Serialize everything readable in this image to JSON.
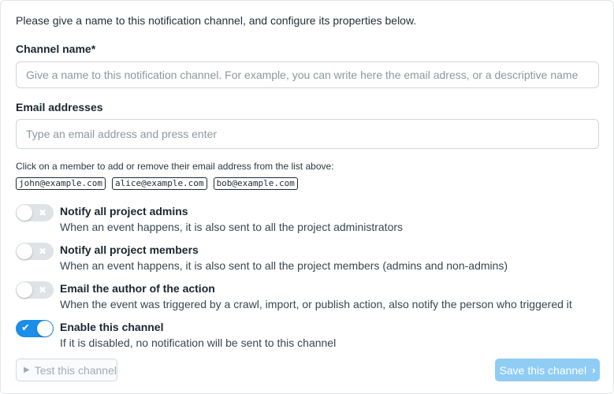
{
  "intro": "Please give a name to this notification channel, and configure its properties below.",
  "channel_name": {
    "label": "Channel name*",
    "value": "",
    "placeholder": "Give a name to this notification channel. For example, you can write here the email adress, or a descriptive name"
  },
  "email": {
    "label": "Email addresses",
    "value": "",
    "placeholder": "Type an email address and press enter"
  },
  "members": {
    "hint": "Click on a member to add or remove their email address from the list above:",
    "items": [
      "john@example.com",
      "alice@example.com",
      "bob@example.com"
    ]
  },
  "options": [
    {
      "title": "Notify all project admins",
      "desc": "When an event happens, it is also sent to all the project administrators",
      "enabled": false,
      "mark": "✖"
    },
    {
      "title": "Notify all project members",
      "desc": "When an event happens, it is also sent to all the project members (admins and non-admins)",
      "enabled": false,
      "mark": "✖"
    },
    {
      "title": "Email the author of the action",
      "desc": "When the event was triggered by a crawl, import, or publish action, also notify the person who triggered it",
      "enabled": false,
      "mark": "✖"
    },
    {
      "title": "Enable this channel",
      "desc": "If it is disabled, no notification will be sent to this channel",
      "enabled": true,
      "mark": "✔"
    }
  ],
  "buttons": {
    "test": "Test this channel",
    "test_icon": "▶",
    "save": "Save this channel",
    "save_icon": "›"
  },
  "colors": {
    "accent": "#1a8ee8",
    "save_disabled": "#8fcdf5",
    "toggle_off": "#dfe3e6"
  }
}
